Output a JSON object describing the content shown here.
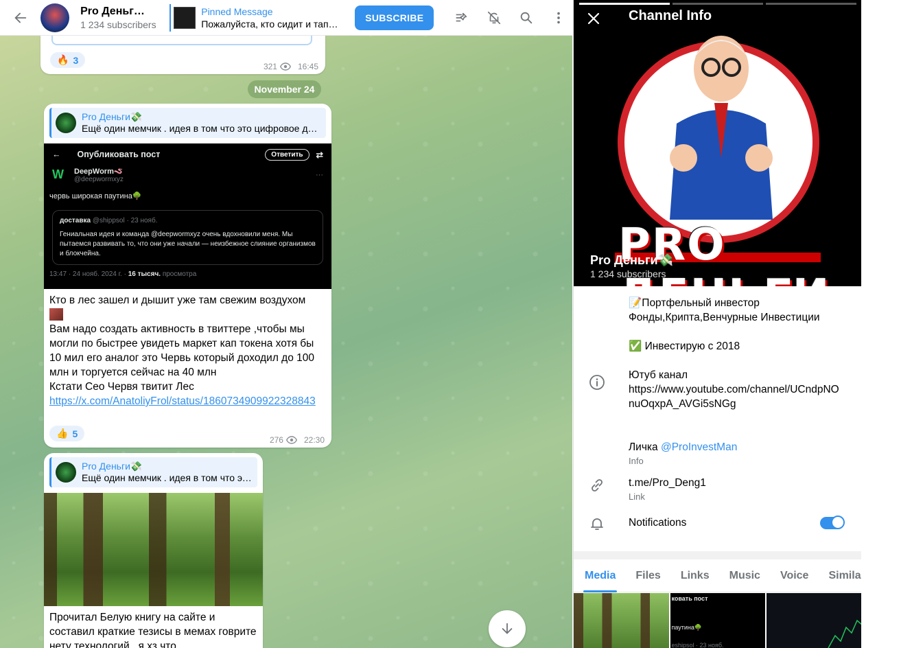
{
  "header": {
    "channel_title": "Pro Деньг…",
    "subscribers": "1 234 subscribers",
    "pinned_label": "Pinned Message",
    "pinned_text": "Пожалуйста, кто сидит и тап…",
    "subscribe_label": "SUBSCRIBE"
  },
  "messages": {
    "m1": {
      "reaction_emoji": "🔥",
      "reaction_count": "3",
      "views": "321",
      "time": "16:45"
    },
    "date_separator": "November 24",
    "m2": {
      "fwd_name": "Pro Деньги💸",
      "fwd_text": "Ещё один мемчик . идея в том что это цифровое де…",
      "tweet": {
        "header": "Опубликовать пост",
        "reply": "Ответить",
        "user": "DeepWorm🪱",
        "handle": "@deepwormxyz",
        "body": "червь широкая паутина🌳",
        "quote_user": "доставка",
        "quote_meta": "@shippsol · 23 нояб.",
        "quote_text": "Гениальная идея и команда @deepwormxyz очень вдохновили меня. Мы пытаемся развивать то, что они уже начали — неизбежное слияние организмов и блокчейна.",
        "foot_time": "13:47 · 24 нояб. 2024 г. ·",
        "foot_views": "16 тысяч.",
        "foot_label": "просмотра"
      },
      "text_1": "Кто в лес зашел и дышит уже там свежим воздухом",
      "text_2": "Вам надо создать активность в твиттере ,чтобы мы могли по быстрее увидеть маркет кап токена хотя бы 10 мил его аналог это Червь который доходил до 100 млн и торгуется сейчас на 40 млн",
      "text_3": "Кстати Сео Червя твитит Лес",
      "link": "https://x.com/AnatoliyFrol/status/1860734909922328843",
      "reaction_emoji": "👍",
      "reaction_count": "5",
      "views": "276",
      "time": "22:30"
    },
    "m3": {
      "fwd_name": "Pro Деньги💸",
      "fwd_text": "Ещё один мемчик . идея в том что эт…",
      "text": "Прочитал Белую книгу на сайте и составил краткие тезисы в мемах говрите нету технологий , я хз что"
    }
  },
  "panel": {
    "title": "Channel Info",
    "brand_text": "PRO ДЕНЬГИ",
    "name": "Pro Деньги💸",
    "subscribers": "1 234 subscribers",
    "desc_line1": "📝Портфельный инвестор",
    "desc_line2": "Фонды,Крипта,Венчурные Инвестиции",
    "desc_line3": "✅ Инвестирую с 2018",
    "desc_line4": "Ютуб канал",
    "desc_line5": "https://www.youtube.com/channel/UCndpNOnuOqxpA_AVGi5sNGg",
    "desc_line6": "Личка",
    "desc_mention": "@ProInvestMan",
    "info_label": "Info",
    "link_value": "t.me/Pro_Deng1",
    "link_label": "Link",
    "notifications_label": "Notifications",
    "notifications_on": true,
    "tabs": [
      "Media",
      "Files",
      "Links",
      "Music",
      "Voice",
      "Simila"
    ],
    "thumb_texts": {
      "t2_header": "ковать пост",
      "t2_line": "паутина🌳",
      "t2_meta": "eshipsol · 23 нояб."
    }
  },
  "colors": {
    "accent": "#3390ec",
    "muted": "#707579"
  }
}
